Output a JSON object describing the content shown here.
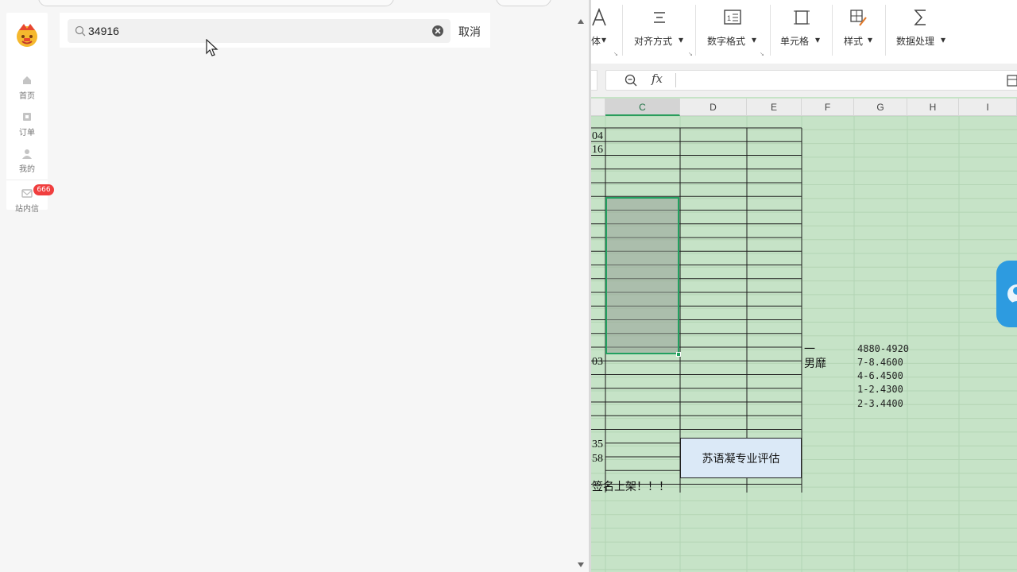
{
  "app": {
    "nav": [
      {
        "id": "home",
        "label": "首页",
        "icon": "home-icon"
      },
      {
        "id": "orders",
        "label": "订单",
        "icon": "orders-icon"
      },
      {
        "id": "mine",
        "label": "我的",
        "icon": "user-icon"
      },
      {
        "id": "inbox",
        "label": "站内信",
        "icon": "mail-icon",
        "badge": "666"
      }
    ],
    "search": {
      "value": "34916",
      "cancel_label": "取消"
    },
    "colors": {
      "badge": "#f03e3e",
      "background": "#f6f6f6"
    }
  },
  "spreadsheet": {
    "ribbon": [
      {
        "label": "体",
        "icon": "font-icon"
      },
      {
        "label": "对齐方式",
        "icon": "align-icon"
      },
      {
        "label": "数字格式",
        "icon": "number-format-icon"
      },
      {
        "label": "单元格",
        "icon": "cell-icon"
      },
      {
        "label": "样式",
        "icon": "style-icon"
      },
      {
        "label": "数据处理",
        "icon": "sum-icon"
      }
    ],
    "formula_bar": {
      "fx": "fx",
      "value": ""
    },
    "columns": [
      "C",
      "D",
      "E",
      "F",
      "G",
      "H",
      "I"
    ],
    "selected_column": "C",
    "b_column_fragments": [
      "04",
      "16",
      "03",
      "35",
      "58"
    ],
    "f_column_text": [
      "一",
      "男靡"
    ],
    "g_column_notes": [
      "4880-4920",
      "7-8.4600",
      "4-6.4500",
      "1-2.4300",
      "2-3.4400"
    ],
    "merged_label": "苏语凝专业评估",
    "footer_note": "签名上架！！！",
    "colors": {
      "sheet_bg": "#c6e3c7",
      "selection": "#22a060",
      "merged_fill": "#dbe9f7"
    }
  }
}
